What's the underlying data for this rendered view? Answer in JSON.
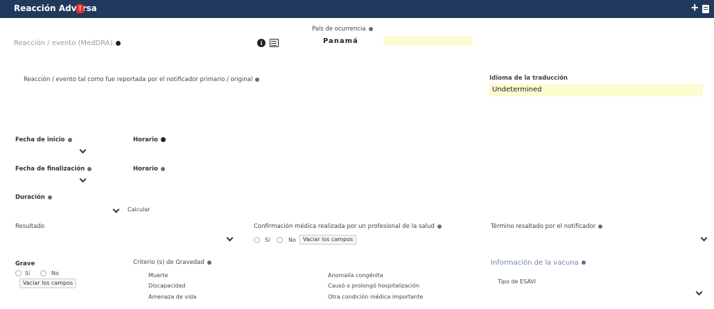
{
  "header": {
    "title": "Reacción Adversa",
    "alert_glyph": "!",
    "add_glyph": "+"
  },
  "reaction_meddra": {
    "label": "Reacción / evento (MedDRA)"
  },
  "country": {
    "label": "País de ocurrencia",
    "value": "Panamá"
  },
  "reaction_original": {
    "label": "Reacción / evento tal como fue reportada por el notificador primario / original"
  },
  "translation_language": {
    "label": "Idioma de la traducción",
    "value": "Undetermined"
  },
  "start_date": {
    "label": "Fecha de inicio"
  },
  "start_time": {
    "label": "Horario"
  },
  "end_date": {
    "label": "Fecha de finalización"
  },
  "end_time": {
    "label": "Horario"
  },
  "duration": {
    "label": "Duración",
    "calc_label": "Calcular"
  },
  "result": {
    "label": "Resultado"
  },
  "medical_confirmation": {
    "label": "Confirmación médica realizada por un profesional de la salud",
    "yes": "Sí",
    "no": "No",
    "clear": "Vaciar los campos"
  },
  "highlighted_term": {
    "label": "Término resaltado por el notificador"
  },
  "serious": {
    "label": "Grave",
    "yes": "Sí",
    "no": "No",
    "clear": "Vaciar los campos"
  },
  "severity_criteria": {
    "label": "Criterio (s) de Gravedad",
    "col1": [
      "Muerte",
      "Discapacidad",
      "Amenaza de vida"
    ],
    "col2": [
      "Anomalía congénita",
      "Causó o prolongó hospitalización",
      "Otra condición médica importante"
    ]
  },
  "vaccine_info": {
    "label": "Información de la vacuna",
    "esavi_label": "Tipo de ESAVI"
  }
}
